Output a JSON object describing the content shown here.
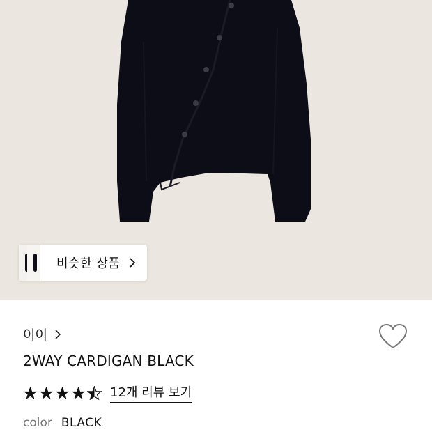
{
  "hero": {
    "image_alt": "black cardigan",
    "similar_products": {
      "label": "비슷한 상품",
      "chevron_icon": "chevron-right-icon"
    }
  },
  "product": {
    "brand": "이이",
    "brand_chevron_icon": "chevron-right-icon",
    "wishlist_icon": "heart-outline-icon",
    "name": "2WAY CARDIGAN BLACK",
    "rating": 4.5,
    "review_link": "12개 리뷰 보기",
    "option_label": "color",
    "option_value": "BLACK"
  },
  "colors": {
    "hero_background": "#ebe7e0",
    "garment": "#0c0d16",
    "star": "#111111"
  }
}
